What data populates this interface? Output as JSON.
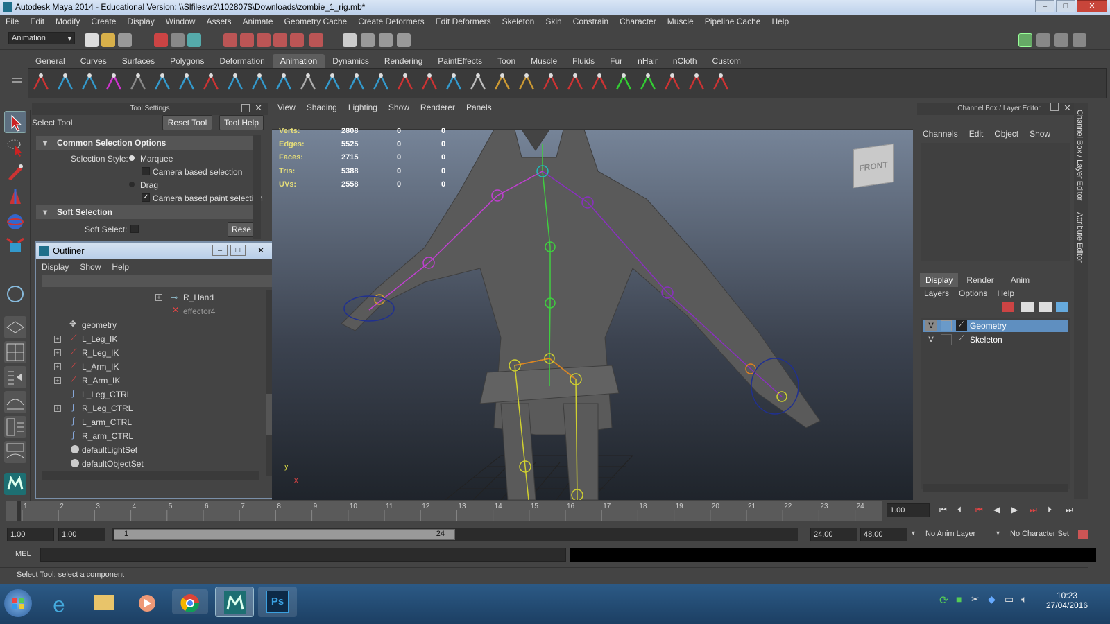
{
  "title_bar": {
    "title": "Autodesk Maya 2014 - Educational Version: \\\\Slfilesvr2\\102807$\\Downloads\\zombie_1_rig.mb*",
    "min": "‒",
    "max": "□",
    "close": "✕"
  },
  "menu": [
    "File",
    "Edit",
    "Modify",
    "Create",
    "Display",
    "Window",
    "Assets",
    "Animate",
    "Geometry Cache",
    "Create Deformers",
    "Edit Deformers",
    "Skeleton",
    "Skin",
    "Constrain",
    "Character",
    "Muscle",
    "Pipeline Cache",
    "Help"
  ],
  "status_line": {
    "menu_set": "Animation"
  },
  "shelf_tabs": [
    "General",
    "Curves",
    "Surfaces",
    "Polygons",
    "Deformation",
    "Animation",
    "Dynamics",
    "Rendering",
    "PaintEffects",
    "Toon",
    "Muscle",
    "Fluids",
    "Fur",
    "nHair",
    "nCloth",
    "Custom"
  ],
  "shelf_active": "Animation",
  "tool_settings": {
    "header": "Tool Settings",
    "tool_name": "Select Tool",
    "reset_button": "Reset Tool",
    "help_button": "Tool Help",
    "section1": "Common Selection Options",
    "selection_style_label": "Selection Style:",
    "marquee": "Marquee",
    "camera_based": "Camera based selection",
    "drag": "Drag",
    "camera_paint": "Camera based paint selection",
    "section2": "Soft Selection",
    "soft_select_label": "Soft Select:",
    "reset_short": "Rese"
  },
  "outliner": {
    "title": "Outliner",
    "menu": [
      "Display",
      "Show",
      "Help"
    ],
    "items": [
      {
        "label": "R_Hand"
      },
      {
        "label": "effector4"
      },
      {
        "label": "geometry"
      },
      {
        "label": "L_Leg_IK"
      },
      {
        "label": "R_Leg_IK"
      },
      {
        "label": "L_Arm_IK"
      },
      {
        "label": "R_Arm_IK"
      },
      {
        "label": "L_Leg_CTRL"
      },
      {
        "label": "R_Leg_CTRL"
      },
      {
        "label": "L_arm_CTRL"
      },
      {
        "label": "R_arm_CTRL"
      },
      {
        "label": "defaultLightSet"
      },
      {
        "label": "defaultObjectSet"
      }
    ]
  },
  "viewport": {
    "menu": [
      "View",
      "Shading",
      "Lighting",
      "Show",
      "Renderer",
      "Panels"
    ],
    "hud": [
      {
        "label": "Verts:",
        "a": "2808",
        "b": "0",
        "c": "0"
      },
      {
        "label": "Edges:",
        "a": "5525",
        "b": "0",
        "c": "0"
      },
      {
        "label": "Faces:",
        "a": "2715",
        "b": "0",
        "c": "0"
      },
      {
        "label": "Tris:",
        "a": "5388",
        "b": "0",
        "c": "0"
      },
      {
        "label": "UVs:",
        "a": "2558",
        "b": "0",
        "c": "0"
      }
    ],
    "view_cube": "FRONT",
    "axis_y": "y",
    "axis_x": "x"
  },
  "channel_box": {
    "header": "Channel Box / Layer Editor",
    "menu": [
      "Channels",
      "Edit",
      "Object",
      "Show"
    ],
    "layer_tabs": [
      "Display",
      "Render",
      "Anim"
    ],
    "layer_menu": [
      "Layers",
      "Options",
      "Help"
    ],
    "layers": [
      {
        "v": "V",
        "name": "Geometry"
      },
      {
        "v": "V",
        "name": "Skeleton"
      }
    ],
    "side_tab1": "Channel Box / Layer Editor",
    "side_tab2": "Attribute Editor"
  },
  "timeline": {
    "ticks": [
      "1",
      "2",
      "3",
      "4",
      "5",
      "6",
      "7",
      "8",
      "9",
      "10",
      "11",
      "12",
      "13",
      "14",
      "15",
      "16",
      "17",
      "18",
      "19",
      "20",
      "21",
      "22",
      "23",
      "24"
    ],
    "current_frame": "1.00"
  },
  "range": {
    "start": "1.00",
    "start2": "1.00",
    "slider_start": "1",
    "slider_end": "24",
    "end": "24.00",
    "end2": "48.00",
    "anim_layer": "No Anim Layer",
    "char_set": "No Character Set"
  },
  "mel": {
    "label": "MEL"
  },
  "help_line": "Select Tool: select a component",
  "taskbar": {
    "time": "10:23",
    "date": "27/04/2016",
    "ps": "Ps"
  }
}
